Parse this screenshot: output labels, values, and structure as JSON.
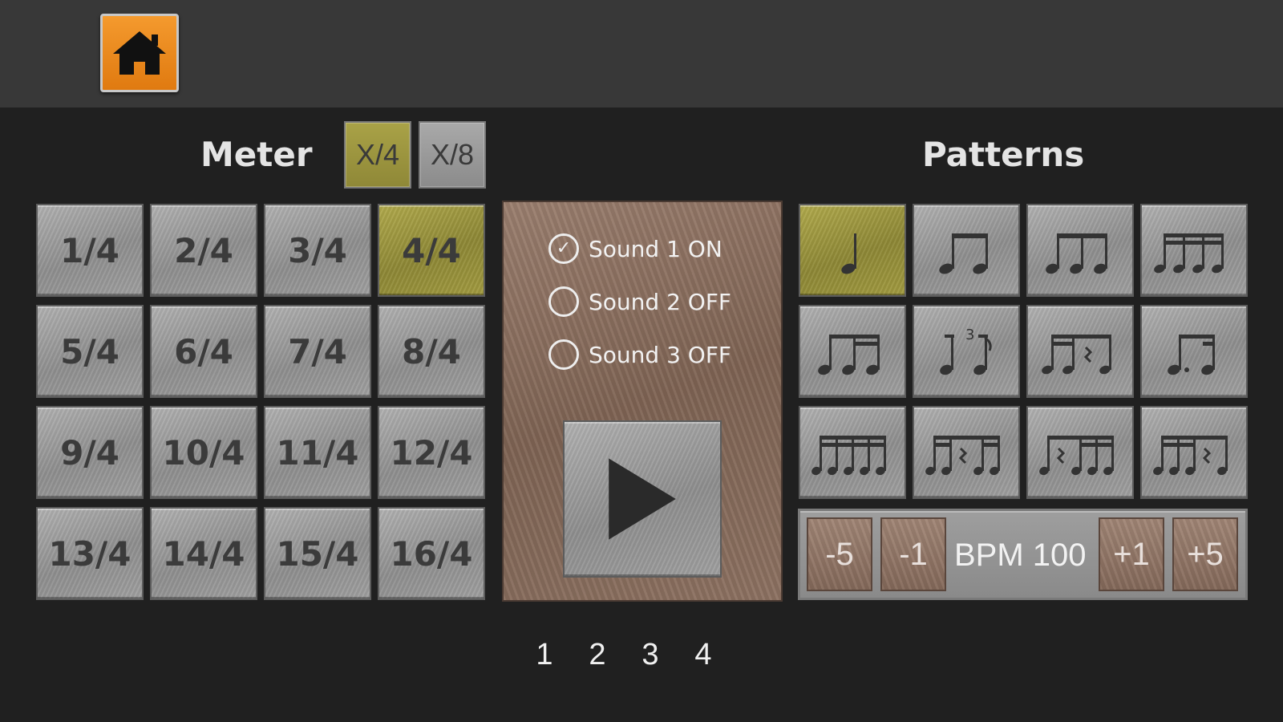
{
  "header": {
    "home_icon": "home-icon",
    "home_color": "#e8841a"
  },
  "meter": {
    "title": "Meter",
    "modes": [
      {
        "label": "X/4",
        "selected": true
      },
      {
        "label": "X/8",
        "selected": false
      }
    ],
    "values": [
      "1/4",
      "2/4",
      "3/4",
      "4/4",
      "5/4",
      "6/4",
      "7/4",
      "8/4",
      "9/4",
      "10/4",
      "11/4",
      "12/4",
      "13/4",
      "14/4",
      "15/4",
      "16/4"
    ],
    "selected": "4/4"
  },
  "sounds": [
    {
      "label": "Sound 1 ON",
      "checked": true
    },
    {
      "label": "Sound 2 OFF",
      "checked": false
    },
    {
      "label": "Sound 3 OFF",
      "checked": false
    }
  ],
  "play_icon": "play-icon",
  "patterns": {
    "title": "Patterns",
    "items": [
      {
        "icon": "quarter-note-icon",
        "selected": true
      },
      {
        "icon": "two-eighths-icon",
        "selected": false
      },
      {
        "icon": "eighth-triplet-icon",
        "selected": false
      },
      {
        "icon": "four-sixteenths-icon",
        "selected": false
      },
      {
        "icon": "eighth-two-sixteenths-icon",
        "selected": false
      },
      {
        "icon": "triplet-rest-icon",
        "selected": false
      },
      {
        "icon": "sixteenths-rest-icon",
        "selected": false
      },
      {
        "icon": "dotted-eighth-sixteenth-icon",
        "selected": false
      },
      {
        "icon": "quintuplet-icon",
        "selected": false
      },
      {
        "icon": "quintuplet-rest-2-icon",
        "selected": false
      },
      {
        "icon": "quintuplet-rest-1-icon",
        "selected": false
      },
      {
        "icon": "quintuplet-rest-4-icon",
        "selected": false
      }
    ]
  },
  "bpm": {
    "minus5": "-5",
    "minus1": "-1",
    "label": "BPM 100",
    "plus1": "+1",
    "plus5": "+5"
  },
  "pages": [
    "1",
    "2",
    "3",
    "4"
  ],
  "colors": {
    "selected": "#a9a247",
    "steel": "#a0a0a0",
    "wood": "#8d7262",
    "background": "#202020",
    "topbar": "#383838"
  }
}
